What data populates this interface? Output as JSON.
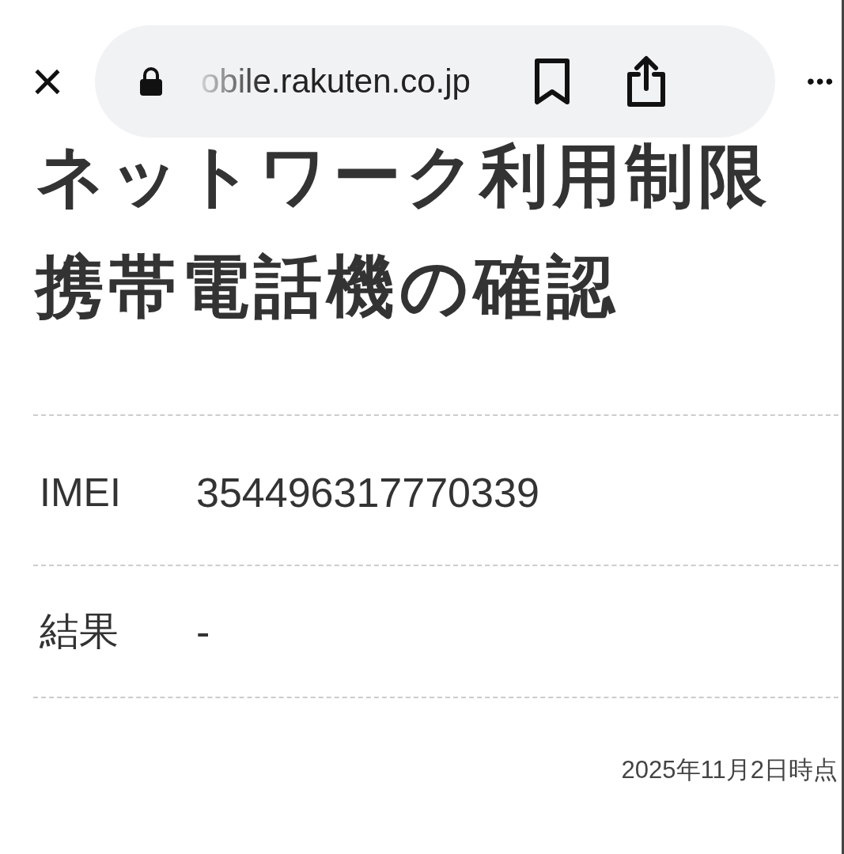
{
  "browser_bar": {
    "close": "×",
    "url": "obile.rakuten.co.jp",
    "more": "•••"
  },
  "title": "ネットワーク利用制限携帯電話機の確認",
  "rows": [
    {
      "label": "IMEI",
      "value": "354496317770339"
    },
    {
      "label": "結果",
      "value": "-"
    }
  ],
  "timestamp": "2025年11月2日時点"
}
